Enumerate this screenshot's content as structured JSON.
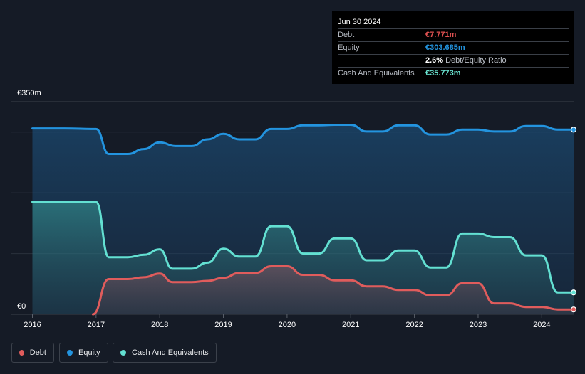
{
  "tooltip": {
    "date": "Jun 30 2024",
    "debt_label": "Debt",
    "debt_value": "€7.771m",
    "equity_label": "Equity",
    "equity_value": "€303.685m",
    "ratio_value": "2.6%",
    "ratio_label": "Debt/Equity Ratio",
    "cash_label": "Cash And Equivalents",
    "cash_value": "€35.773m"
  },
  "colors": {
    "background": "#151b26",
    "debt": "#e05c5c",
    "equity": "#2394df",
    "cash": "#63e0d2",
    "debt_text": "#e05252",
    "equity_text": "#2394df",
    "cash_text": "#6be6d3"
  },
  "legend": [
    {
      "label": "Debt",
      "color": "#e05c5c"
    },
    {
      "label": "Equity",
      "color": "#2394df"
    },
    {
      "label": "Cash And Equivalents",
      "color": "#63e0d2"
    }
  ],
  "chart_data": {
    "type": "area",
    "ylim": [
      0,
      350
    ],
    "y_tick_labels": [
      "€350m",
      "€0"
    ],
    "x_tick_labels": [
      "2016",
      "2017",
      "2018",
      "2019",
      "2020",
      "2021",
      "2022",
      "2023",
      "2024"
    ],
    "x_ticks": [
      2016,
      2017,
      2018,
      2019,
      2020,
      2021,
      2022,
      2023,
      2024
    ],
    "xlim": [
      2015.67,
      2024.5
    ],
    "grid": true,
    "series": [
      {
        "name": "Equity",
        "points": [
          [
            2016.0,
            306
          ],
          [
            2016.5,
            306
          ],
          [
            2017.0,
            305
          ],
          [
            2017.2,
            264
          ],
          [
            2017.5,
            264
          ],
          [
            2017.75,
            272
          ],
          [
            2018.0,
            283
          ],
          [
            2018.25,
            277
          ],
          [
            2018.5,
            277
          ],
          [
            2018.75,
            288
          ],
          [
            2019.0,
            297
          ],
          [
            2019.25,
            288
          ],
          [
            2019.5,
            288
          ],
          [
            2019.75,
            305
          ],
          [
            2020.0,
            305
          ],
          [
            2020.25,
            311
          ],
          [
            2020.5,
            311
          ],
          [
            2020.75,
            312
          ],
          [
            2021.0,
            312
          ],
          [
            2021.25,
            301
          ],
          [
            2021.5,
            301
          ],
          [
            2021.75,
            311
          ],
          [
            2022.0,
            311
          ],
          [
            2022.25,
            296
          ],
          [
            2022.5,
            296
          ],
          [
            2022.75,
            304
          ],
          [
            2023.0,
            304
          ],
          [
            2023.25,
            301
          ],
          [
            2023.5,
            301
          ],
          [
            2023.75,
            310
          ],
          [
            2024.0,
            310
          ],
          [
            2024.25,
            304
          ],
          [
            2024.5,
            304
          ]
        ]
      },
      {
        "name": "Cash And Equivalents",
        "points": [
          [
            2016.0,
            185
          ],
          [
            2016.5,
            185
          ],
          [
            2017.0,
            185
          ],
          [
            2017.2,
            94
          ],
          [
            2017.5,
            94
          ],
          [
            2017.75,
            98
          ],
          [
            2018.0,
            107
          ],
          [
            2018.2,
            75
          ],
          [
            2018.5,
            75
          ],
          [
            2018.75,
            85
          ],
          [
            2019.0,
            108
          ],
          [
            2019.25,
            95
          ],
          [
            2019.5,
            95
          ],
          [
            2019.75,
            145
          ],
          [
            2020.0,
            145
          ],
          [
            2020.25,
            100
          ],
          [
            2020.5,
            100
          ],
          [
            2020.75,
            125
          ],
          [
            2021.0,
            125
          ],
          [
            2021.25,
            89
          ],
          [
            2021.5,
            89
          ],
          [
            2021.75,
            105
          ],
          [
            2022.0,
            105
          ],
          [
            2022.25,
            77
          ],
          [
            2022.5,
            77
          ],
          [
            2022.75,
            133
          ],
          [
            2023.0,
            133
          ],
          [
            2023.25,
            127
          ],
          [
            2023.5,
            127
          ],
          [
            2023.75,
            97
          ],
          [
            2024.0,
            97
          ],
          [
            2024.25,
            36
          ],
          [
            2024.5,
            36
          ]
        ]
      },
      {
        "name": "Debt",
        "points": [
          [
            2016.95,
            0
          ],
          [
            2017.2,
            58
          ],
          [
            2017.5,
            58
          ],
          [
            2017.75,
            61
          ],
          [
            2018.0,
            67
          ],
          [
            2018.2,
            53
          ],
          [
            2018.5,
            53
          ],
          [
            2018.75,
            55
          ],
          [
            2019.0,
            60
          ],
          [
            2019.25,
            68
          ],
          [
            2019.5,
            68
          ],
          [
            2019.75,
            79
          ],
          [
            2020.0,
            79
          ],
          [
            2020.25,
            65
          ],
          [
            2020.5,
            65
          ],
          [
            2020.75,
            56
          ],
          [
            2021.0,
            56
          ],
          [
            2021.25,
            46
          ],
          [
            2021.5,
            46
          ],
          [
            2021.75,
            40
          ],
          [
            2022.0,
            40
          ],
          [
            2022.25,
            31
          ],
          [
            2022.5,
            31
          ],
          [
            2022.75,
            51
          ],
          [
            2023.0,
            51
          ],
          [
            2023.25,
            18
          ],
          [
            2023.5,
            18
          ],
          [
            2023.75,
            12
          ],
          [
            2024.0,
            12
          ],
          [
            2024.25,
            8
          ],
          [
            2024.5,
            8
          ]
        ]
      }
    ]
  }
}
